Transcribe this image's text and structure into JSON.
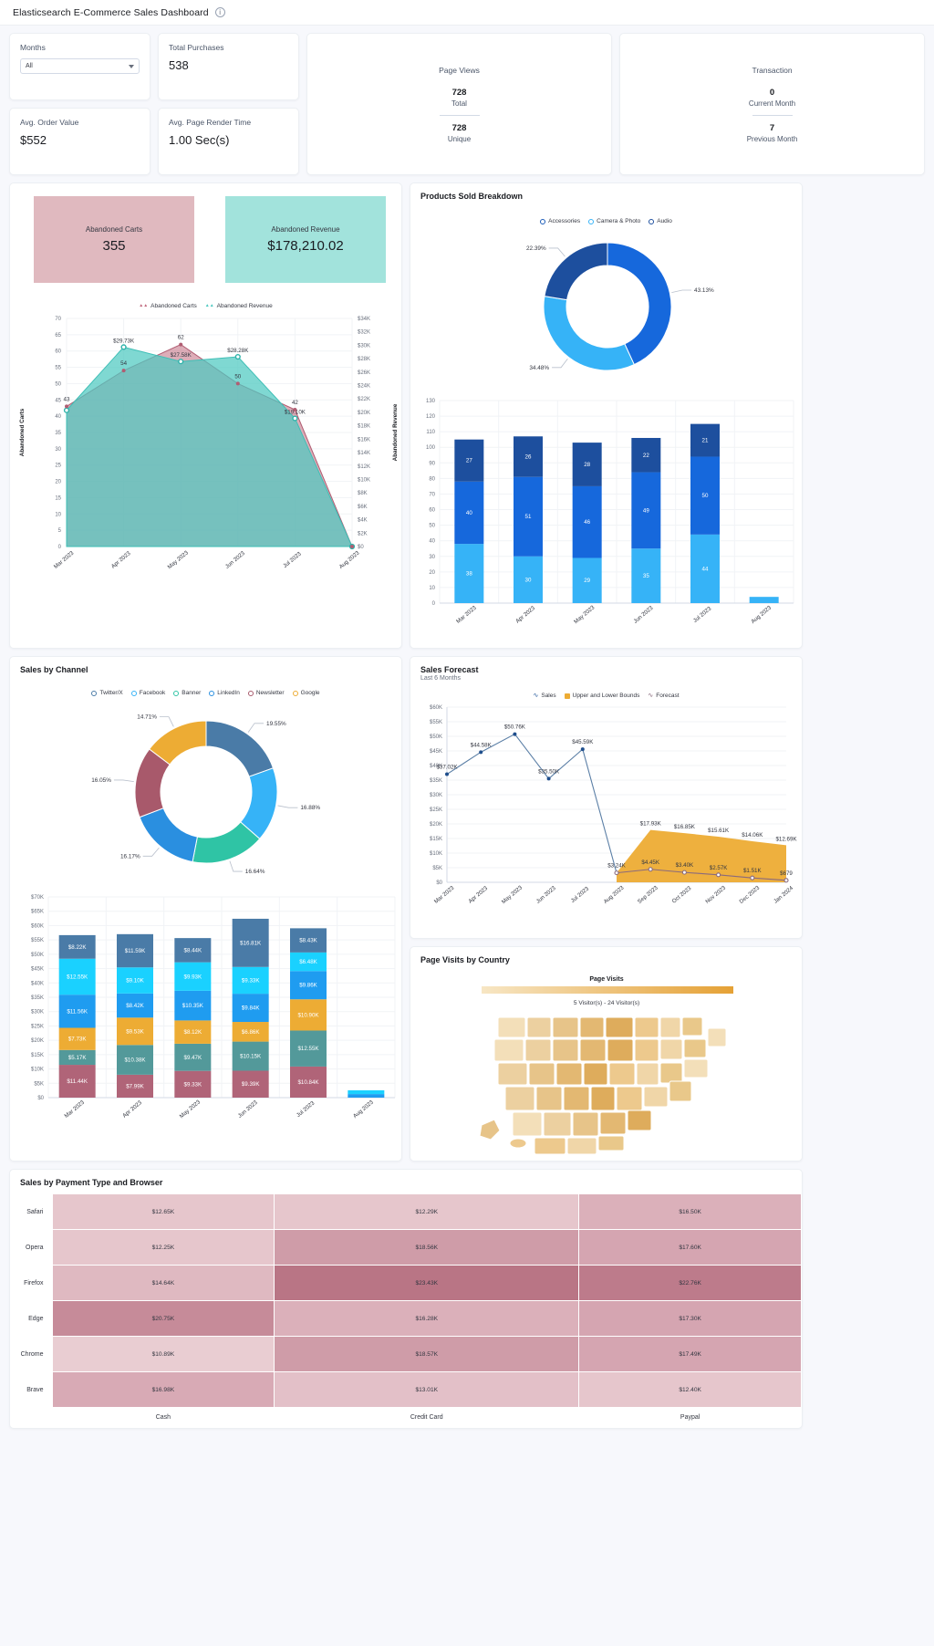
{
  "app": {
    "title": "Elasticsearch E-Commerce Sales Dashboard",
    "info_icon": "info-icon"
  },
  "filters": {
    "months_label": "Months",
    "months_value": "All"
  },
  "kpis": {
    "total_purchases_label": "Total Purchases",
    "total_purchases_value": "538",
    "avg_order_value_label": "Avg. Order Value",
    "avg_order_value_value": "$552",
    "avg_page_render_label": "Avg. Page Render Time",
    "avg_page_render_value": "1.00 Sec(s)",
    "page_views_title": "Page Views",
    "page_views_total": "728",
    "page_views_total_cap": "Total",
    "page_views_unique": "728",
    "page_views_unique_cap": "Unique",
    "transaction_title": "Transaction",
    "transaction_current": "0",
    "transaction_current_cap": "Current Month",
    "transaction_previous": "7",
    "transaction_previous_cap": "Previous Month"
  },
  "abandoned": {
    "carts_label": "Abandoned Carts",
    "carts_value": "355",
    "carts_color": "#e0b9bf",
    "revenue_label": "Abandoned Revenue",
    "revenue_value": "$178,210.02",
    "revenue_color": "#a2e3dc"
  },
  "chart_data": [
    {
      "id": "abandoned_chart",
      "type": "area",
      "title": "",
      "legend": [
        {
          "name": "Abandoned Carts",
          "color": "#c1697e"
        },
        {
          "name": "Abandoned Revenue",
          "color": "#4ec9c0"
        }
      ],
      "categories": [
        "Mar 2023",
        "Apr 2023",
        "May 2023",
        "Jun 2023",
        "Jul 2023",
        "Aug 2023"
      ],
      "ylabel": "Abandoned Carts",
      "y2label": "Abandoned Revenue",
      "ylim": [
        0,
        70
      ],
      "yticks": [
        "0",
        "5",
        "10",
        "15",
        "20",
        "25",
        "30",
        "35",
        "40",
        "45",
        "50",
        "55",
        "60",
        "65",
        "70"
      ],
      "y2ticks": [
        "$0",
        "$2K",
        "$4K",
        "$6K",
        "$8K",
        "$10K",
        "$12K",
        "$14K",
        "$16K",
        "$18K",
        "$20K",
        "$22K",
        "$24K",
        "$26K",
        "$28K",
        "$30K",
        "$32K",
        "$34K"
      ],
      "y2lim": [
        0,
        34000
      ],
      "series": [
        {
          "name": "Abandoned Carts",
          "color": "#c1697e",
          "values": [
            43,
            54,
            62,
            50,
            42,
            0
          ],
          "labels": [
            "43",
            "54",
            "62",
            "50",
            "42",
            ""
          ]
        },
        {
          "name": "Abandoned Revenue",
          "color": "#4ec9c0",
          "values": [
            20300,
            29730,
            27580,
            28280,
            19100,
            0
          ],
          "labels": [
            "",
            "$29.73K",
            "$27.58K",
            "$28.28K",
            "$19.10K",
            ""
          ]
        }
      ]
    },
    {
      "id": "products_donut",
      "type": "pie",
      "title": "Products Sold Breakdown",
      "legend": [
        {
          "name": "Accessories",
          "color": "#1a5bb8"
        },
        {
          "name": "Camera & Photo",
          "color": "#36b3f7"
        },
        {
          "name": "Audio",
          "color": "#1d4f9e"
        }
      ],
      "slices": [
        {
          "label": "43.13%",
          "value": 43.13,
          "color": "#1668dc"
        },
        {
          "label": "34.48%",
          "value": 34.48,
          "color": "#36b3f7"
        },
        {
          "label": "22.39%",
          "value": 22.39,
          "color": "#1d4f9e"
        }
      ]
    },
    {
      "id": "products_bars",
      "type": "bar",
      "stacked": true,
      "categories": [
        "Mar 2023",
        "Apr 2023",
        "May 2023",
        "Jun 2023",
        "Jul 2023",
        "Aug 2023"
      ],
      "ylim": [
        0,
        130
      ],
      "yticks": [
        "0",
        "10",
        "20",
        "30",
        "40",
        "50",
        "60",
        "70",
        "80",
        "90",
        "100",
        "110",
        "120",
        "130"
      ],
      "series": [
        {
          "name": "Camera & Photo",
          "color": "#36b3f7",
          "values": [
            38,
            30,
            29,
            35,
            44,
            4
          ],
          "labels": [
            "38",
            "30",
            "29",
            "35",
            "44",
            "4"
          ]
        },
        {
          "name": "Accessories",
          "color": "#1668dc",
          "values": [
            40,
            51,
            46,
            49,
            50,
            0
          ],
          "labels": [
            "40",
            "51",
            "46",
            "49",
            "50",
            ""
          ]
        },
        {
          "name": "Audio",
          "color": "#1d4f9e",
          "values": [
            27,
            26,
            28,
            22,
            21,
            0
          ],
          "labels": [
            "27",
            "26",
            "28",
            "22",
            "21",
            ""
          ]
        }
      ]
    },
    {
      "id": "channel_donut",
      "type": "pie",
      "title": "Sales by Channel",
      "legend": [
        {
          "name": "Twitter/X",
          "color": "#4a7ba7"
        },
        {
          "name": "Facebook",
          "color": "#36b3f7"
        },
        {
          "name": "Banner",
          "color": "#2fc4a5"
        },
        {
          "name": "LinkedIn",
          "color": "#2a8fe0"
        },
        {
          "name": "Newsletter",
          "color": "#a8596b"
        },
        {
          "name": "Google",
          "color": "#edac34"
        }
      ],
      "slices": [
        {
          "label": "19.55%",
          "value": 19.55,
          "color": "#4a7ba7"
        },
        {
          "label": "16.88%",
          "value": 16.88,
          "color": "#36b3f7"
        },
        {
          "label": "16.64%",
          "value": 16.64,
          "color": "#2fc4a5"
        },
        {
          "label": "16.17%",
          "value": 16.17,
          "color": "#2a8fe0"
        },
        {
          "label": "16.05%",
          "value": 16.05,
          "color": "#a8596b"
        },
        {
          "label": "14.71%",
          "value": 14.71,
          "color": "#edac34"
        }
      ]
    },
    {
      "id": "channel_bars",
      "type": "bar",
      "stacked": true,
      "categories": [
        "Mar 2023",
        "Apr 2023",
        "May 2023",
        "Jun 2023",
        "Jul 2023",
        "Aug 2023"
      ],
      "ylim": [
        0,
        70000
      ],
      "yticks": [
        "$0",
        "$5K",
        "$10K",
        "$15K",
        "$20K",
        "$25K",
        "$30K",
        "$35K",
        "$40K",
        "$45K",
        "$50K",
        "$55K",
        "$60K",
        "$65K",
        "$70K"
      ],
      "series": [
        {
          "name": "Newsletter",
          "color": "#b06478",
          "values": [
            11440,
            7990,
            9330,
            9390,
            10840,
            0
          ],
          "labels": [
            "$11.44K",
            "$7.99K",
            "$9.33K",
            "$9.39K",
            "$10.84K",
            ""
          ]
        },
        {
          "name": "Banner",
          "color": "#53999a",
          "values": [
            5170,
            10380,
            9470,
            10150,
            12550,
            0
          ],
          "labels": [
            "$5.17K",
            "$10.38K",
            "$9.47K",
            "$10.15K",
            "$12.55K",
            ""
          ]
        },
        {
          "name": "Google",
          "color": "#edac34",
          "values": [
            7730,
            9530,
            8120,
            6860,
            10900,
            0
          ],
          "labels": [
            "$7.73K",
            "$9.53K",
            "$8.12K",
            "$6.86K",
            "$10.90K",
            ""
          ]
        },
        {
          "name": "LinkedIn",
          "color": "#1f9cf0",
          "values": [
            11560,
            8420,
            10350,
            9840,
            9860,
            1240
          ],
          "labels": [
            "$11.56K",
            "$8.42K",
            "$10.35K",
            "$9.84K",
            "$9.86K",
            "$1.24K"
          ]
        },
        {
          "name": "Facebook",
          "color": "#1ad1ff",
          "values": [
            12550,
            9100,
            9930,
            9330,
            6480,
            1320
          ],
          "labels": [
            "$12.55K",
            "$9.10K",
            "$9.93K",
            "$9.33K",
            "$6.48K",
            "$1.32K"
          ]
        },
        {
          "name": "Twitter/X",
          "color": "#4a7ba7",
          "values": [
            8220,
            11590,
            8440,
            16810,
            8430,
            0
          ],
          "labels": [
            "$8.22K",
            "$11.59K",
            "$8.44K",
            "$16.81K",
            "$8.43K",
            ""
          ]
        }
      ]
    },
    {
      "id": "sales_forecast",
      "type": "line",
      "title": "Sales Forecast",
      "subtitle": "Last 6 Months",
      "legend": [
        {
          "name": "Sales",
          "color": "#2a5d9e",
          "kind": "wave"
        },
        {
          "name": "Upper and Lower Bounds",
          "color": "#edac34",
          "kind": "square"
        },
        {
          "name": "Forecast",
          "color": "#8a6a7d",
          "kind": "wave"
        }
      ],
      "categories": [
        "Mar 2023",
        "Apr 2023",
        "May 2023",
        "Jun 2023",
        "Jul 2023",
        "Aug 2023",
        "Sep 2023",
        "Oct 2023",
        "Nov 2023",
        "Dec 2023",
        "Jan 2024"
      ],
      "ylim": [
        0,
        60000
      ],
      "yticks": [
        "$0",
        "$5K",
        "$10K",
        "$15K",
        "$20K",
        "$25K",
        "$30K",
        "$35K",
        "$40K",
        "$45K",
        "$50K",
        "$55K",
        "$60K"
      ],
      "series": [
        {
          "name": "Sales",
          "color": "#2a5d9e",
          "values": [
            37020,
            44580,
            50760,
            35500,
            45590,
            3240,
            null,
            null,
            null,
            null,
            null
          ],
          "labels": [
            "$37.02K",
            "$44.58K",
            "$50.76K",
            "$35.50K",
            "$45.59K",
            "$3.24K",
            "",
            "",
            "",
            "",
            ""
          ]
        },
        {
          "name": "Forecast",
          "color": "#8a6a7d",
          "values": [
            null,
            null,
            null,
            null,
            null,
            3240,
            4450,
            3400,
            2570,
            1510,
            679
          ],
          "labels": [
            "",
            "",
            "",
            "",
            "",
            "",
            "$4.45K",
            "$3.40K",
            "$2.57K",
            "$1.51K",
            "$679"
          ]
        },
        {
          "name": "Upper and Lower Bounds",
          "color": "#edac34",
          "upper": [
            null,
            null,
            null,
            null,
            null,
            3240,
            17930,
            16850,
            15610,
            14060,
            12690
          ],
          "lower": [
            null,
            null,
            null,
            null,
            null,
            0,
            0,
            0,
            0,
            0,
            0
          ],
          "labels": [
            "",
            "",
            "",
            "",
            "",
            "",
            "$17.93K",
            "$16.85K",
            "$15.61K",
            "$14.06K",
            "$12.69K"
          ]
        }
      ]
    },
    {
      "id": "page_visits_map",
      "type": "heatmap",
      "title": "Page Visits by Country",
      "legend_title": "Page Visits",
      "legend_caption": "5 Visitor(s) - 24 Visitor(s)",
      "low_color": "#f7e6c4",
      "high_color": "#e5a135"
    },
    {
      "id": "payment_browser_heat",
      "type": "heatmap",
      "title": "Sales by Payment Type and Browser",
      "columns": [
        "Cash",
        "Credit Card",
        "Paypal"
      ],
      "rows": [
        "Safari",
        "Opera",
        "Firefox",
        "Edge",
        "Chrome",
        "Brave"
      ],
      "cells": [
        [
          {
            "label": "$12.65K",
            "color": "#e6c6cc"
          },
          {
            "label": "$12.29K",
            "color": "#e6c6cc"
          },
          {
            "label": "$16.50K",
            "color": "#dbb0ba"
          }
        ],
        [
          {
            "label": "$12.25K",
            "color": "#e6c6cc"
          },
          {
            "label": "$18.56K",
            "color": "#cf9ca8"
          },
          {
            "label": "$17.60K",
            "color": "#d5a5b1"
          }
        ],
        [
          {
            "label": "$14.64K",
            "color": "#dfb9c1"
          },
          {
            "label": "$23.43K",
            "color": "#b97585"
          },
          {
            "label": "$22.76K",
            "color": "#bd7b8b"
          }
        ],
        [
          {
            "label": "$20.75K",
            "color": "#c68b99"
          },
          {
            "label": "$16.28K",
            "color": "#dbb0ba"
          },
          {
            "label": "$17.30K",
            "color": "#d5a5b1"
          }
        ],
        [
          {
            "label": "$10.89K",
            "color": "#e9cdd2"
          },
          {
            "label": "$18.57K",
            "color": "#cf9ca8"
          },
          {
            "label": "$17.49K",
            "color": "#d5a5b1"
          }
        ],
        [
          {
            "label": "$16.98K",
            "color": "#d8aab5"
          },
          {
            "label": "$13.01K",
            "color": "#e3c0c8"
          },
          {
            "label": "$12.40K",
            "color": "#e6c6cc"
          }
        ]
      ]
    }
  ]
}
